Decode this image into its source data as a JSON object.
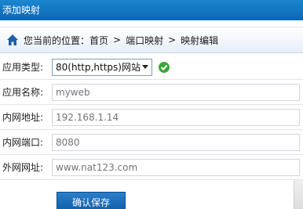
{
  "window": {
    "title": "添加映射"
  },
  "breadcrumb": {
    "prefix": "您当前的位置：",
    "items": [
      "首页",
      "端口映射",
      "映射编辑"
    ],
    "separator": ">"
  },
  "form": {
    "app_type": {
      "label": "应用类型:",
      "value": "80(http,https)网站"
    },
    "app_name": {
      "label": "应用名称:",
      "placeholder": "myweb"
    },
    "lan_address": {
      "label": "内网地址:",
      "placeholder": "192.168.1.14"
    },
    "lan_port": {
      "label": "内网端口:",
      "placeholder": "8080"
    },
    "wan_address": {
      "label": "外网网址:",
      "placeholder": "www.nat123.com"
    }
  },
  "actions": {
    "save_label": "确认保存"
  },
  "colors": {
    "titlebar": "#0b66b2",
    "accent": "#0d5aa3",
    "ok": "#3aa83a"
  }
}
